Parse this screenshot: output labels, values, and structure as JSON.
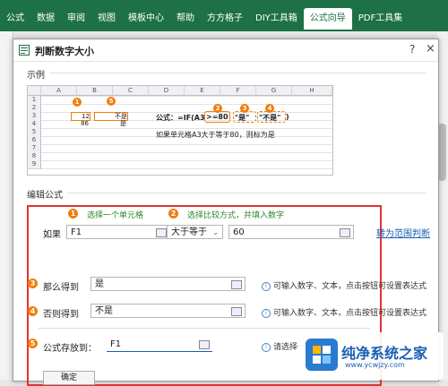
{
  "ribbon": {
    "tabs": [
      "公式",
      "数据",
      "审阅",
      "视图",
      "模板中心",
      "帮助",
      "方方格子",
      "DIY工具箱",
      "公式向导",
      "PDF工具集"
    ],
    "active_index": 8
  },
  "dialog": {
    "title": "判断数字大小",
    "help": "?",
    "close": "×",
    "example_label": "示例",
    "edit_label": "编辑公式"
  },
  "sheet": {
    "cols": [
      "A",
      "B",
      "C",
      "D",
      "E",
      "F",
      "G",
      "H"
    ],
    "rows": [
      "1",
      "2",
      "3",
      "4",
      "5",
      "6",
      "7",
      "8",
      "9"
    ],
    "a3": "12",
    "b3": "不是",
    "a4": "86",
    "b4": "是",
    "formula_prefix": "公式：=IF(A3",
    "formula_cond": ">=80",
    "formula_true": "\"是\"",
    "formula_false": "\"不是\"",
    "formula_end": ")",
    "note": "如果单元格A3大于等于80，则标为是",
    "badges": [
      "1",
      "2",
      "3",
      "4",
      "5"
    ]
  },
  "form": {
    "hint1_num": "1",
    "hint1": "选择一个单元格",
    "hint2_num": "2",
    "hint2": "选择比较方式，并填入数字",
    "if_label": "如果",
    "cell_value": "F1",
    "compare_value": "大于等于",
    "number_value": "60",
    "range_link": "转为范围判断",
    "then_num": "3",
    "then_label": "那么得到",
    "then_value": "是",
    "else_num": "4",
    "else_label": "否则得到",
    "else_value": "不是",
    "info_text": "可输入数字、文本，点击按钮可设置表达式",
    "info_text2": "可输入数字、文本，点击按钮可设置表达式",
    "store_num": "5",
    "store_label": "公式存放到：",
    "store_value": "F1",
    "store_hint": "请选择一个单元格",
    "ok_label": "确定"
  },
  "watermark": {
    "line1": "纯净系统之家",
    "line2": "www.ycwjzy.com"
  },
  "colors": {
    "accent": "#1e7145",
    "orange": "#f07d0a",
    "frame": "#e23333",
    "link": "#1a5fb4"
  }
}
